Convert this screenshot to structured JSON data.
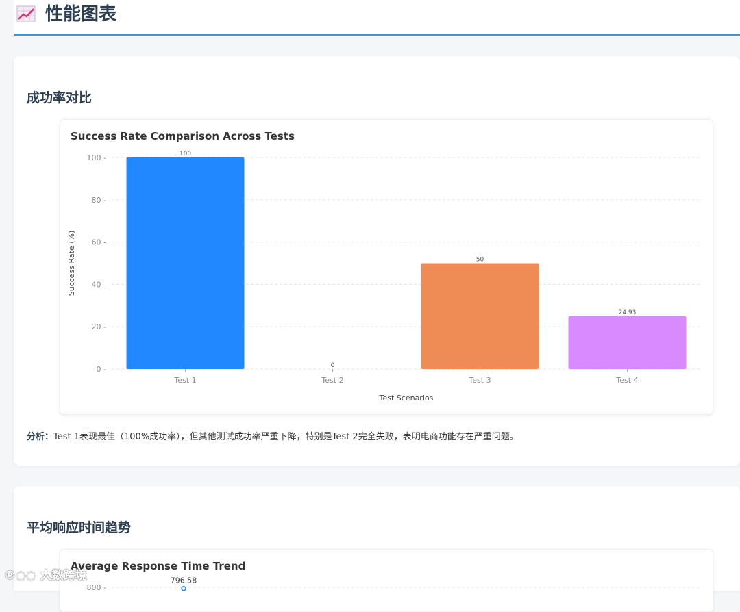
{
  "header": {
    "title": "性能图表",
    "icon": "chart-increasing-icon"
  },
  "sections": [
    {
      "heading": "成功率对比",
      "analysis_label": "分析：",
      "analysis_text": "Test 1表现最佳（100%成功率），但其他测试成功率严重下降，特别是Test 2完全失败，表明电商功能存在严重问题。"
    },
    {
      "heading": "平均响应时间趋势"
    }
  ],
  "chart_data": [
    {
      "type": "bar",
      "title": "Success Rate Comparison Across Tests",
      "xlabel": "Test Scenarios",
      "ylabel": "Success Rate (%)",
      "categories": [
        "Test 1",
        "Test 2",
        "Test 3",
        "Test 4"
      ],
      "values": [
        100,
        0,
        50,
        24.93
      ],
      "value_labels": [
        "100",
        "0",
        "50",
        "24.93"
      ],
      "colors": [
        "#2288ff",
        "#2288ff",
        "#ef8c55",
        "#d98aff"
      ],
      "ylim": [
        0,
        100
      ],
      "yticks": [
        0,
        20,
        40,
        60,
        80,
        100
      ],
      "grid": true
    },
    {
      "type": "line",
      "title": "Average Response Time Trend",
      "visible_points": [
        {
          "label": "796.58",
          "value": 796.58
        }
      ],
      "yticks_visible": [
        800
      ]
    }
  ],
  "watermark": "大数跨境"
}
